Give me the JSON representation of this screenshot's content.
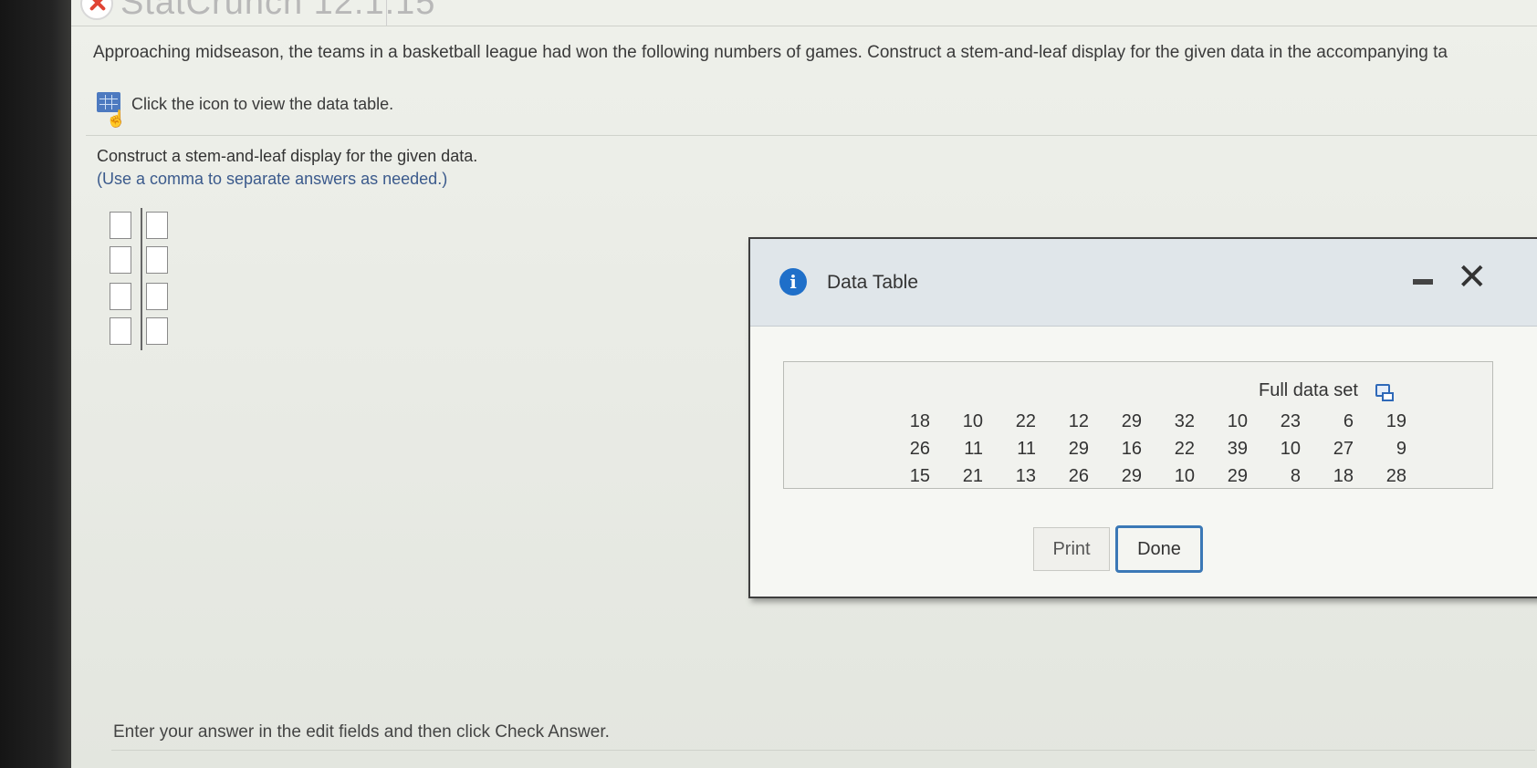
{
  "app": {
    "title": "StatCrunch 12.1.15"
  },
  "question": {
    "text": "Approaching midseason, the teams in a basketball league had won the following numbers of games. Construct a stem-and-leaf display for the given data in the accompanying ta",
    "data_link_text": "Click the icon to view the data table.",
    "instruction": "Construct a stem-and-leaf display for the given data.",
    "hint": "(Use a comma to separate answers as needed.)"
  },
  "dialog": {
    "title": "Data Table",
    "full_data_set_label": "Full data set",
    "rows": [
      [
        "18",
        "10",
        "22",
        "12",
        "29",
        "32",
        "10",
        "23",
        "6",
        "19"
      ],
      [
        "26",
        "11",
        "11",
        "29",
        "16",
        "22",
        "39",
        "10",
        "27",
        "9"
      ],
      [
        "15",
        "21",
        "13",
        "26",
        "29",
        "10",
        "29",
        "8",
        "18",
        "28"
      ]
    ],
    "print_label": "Print",
    "done_label": "Done"
  },
  "footer": {
    "text": "Enter your answer in the edit fields and then click Check Answer."
  },
  "colors": {
    "accent": "#3b78b6",
    "info_icon": "#1f6fc9",
    "close_icon": "#e04434"
  }
}
